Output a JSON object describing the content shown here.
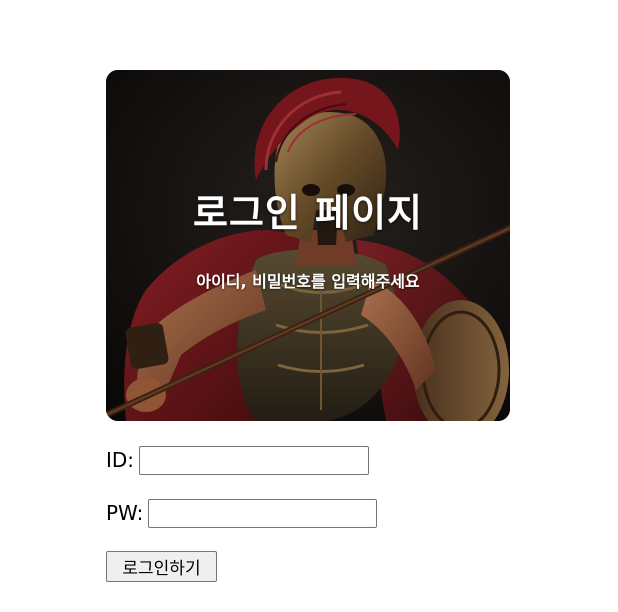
{
  "hero": {
    "title": "로그인 페이지",
    "subtitle": "아이디, 비밀번호를 입력해주세요"
  },
  "form": {
    "id_label": "ID:",
    "id_value": "",
    "id_placeholder": "",
    "pw_label": "PW:",
    "pw_value": "",
    "pw_placeholder": "",
    "submit_label": "로그인하기"
  },
  "colors": {
    "hero_background": "#1a1614",
    "helmet_bronze": "#8a6a3a",
    "crest_red": "#8e1b23",
    "cape_red": "#7a1a1c",
    "skin": "#b5714d",
    "text_on_hero": "#ffffff",
    "button_background": "#efefef",
    "field_border": "#767676"
  }
}
